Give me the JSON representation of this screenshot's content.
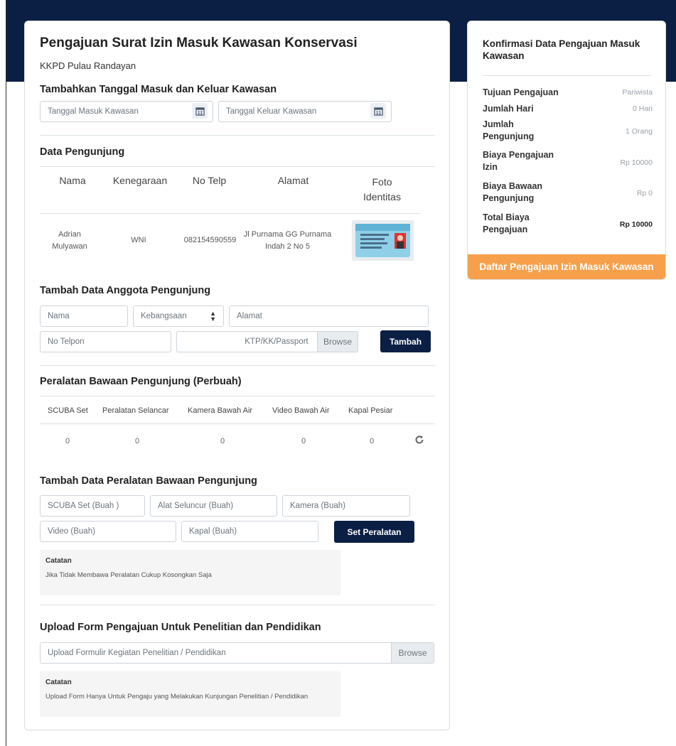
{
  "form": {
    "title": "Pengajuan Surat Izin Masuk Kawasan Konservasi",
    "subtitle": "KKPD Pulau Randayan",
    "dates_section": {
      "heading": "Tambahkan Tanggal Masuk dan Keluar Kawasan",
      "entry_placeholder": "Tanggal Masuk Kawasan",
      "exit_placeholder": "Tanggal Keluar Kawasan"
    },
    "visitors_section": {
      "heading": "Data Pengunjung",
      "columns": [
        "Nama",
        "Kenegaraan",
        "No Telp",
        "Alamat",
        "Foto Identitas"
      ],
      "rows": [
        {
          "nama": "Adrian Mulyawan",
          "kenegaraan": "WNI",
          "no_telp": "082154590559",
          "alamat": "Jl Purnama GG Purnama Indah 2 No 5"
        }
      ]
    },
    "add_member_section": {
      "heading": "Tambah Data Anggota Pengunjung",
      "name_placeholder": "Nama",
      "nationality_selected": "Kebangsaan",
      "address_placeholder": "Alamat",
      "phone_placeholder": "No Telpon",
      "id_file_placeholder": "KTP/KK/Passport",
      "browse_label": "Browse",
      "add_button": "Tambah"
    },
    "equipment_section": {
      "heading": "Peralatan Bawaan Pengunjung (Perbuah)",
      "columns": [
        "SCUBA Set",
        "Peralatan Selancar",
        "Kamera Bawah Air",
        "Video Bawah Air",
        "Kapal Pesiar"
      ],
      "values": [
        "0",
        "0",
        "0",
        "0",
        "0"
      ],
      "reset_icon": "refresh-icon"
    },
    "add_equipment_section": {
      "heading": "Tambah Data Peralatan Bawaan Pengunjung",
      "scuba_placeholder": "SCUBA Set (Buah )",
      "surf_placeholder": "Alat Seluncur (Buah)",
      "camera_placeholder": "Kamera (Buah)",
      "video_placeholder": "Video (Buah)",
      "boat_placeholder": "Kapal (Buah)",
      "set_button": "Set Peralatan",
      "note_title": "Catatan",
      "note_text": "Jika Tidak Membawa Peralatan Cukup Kosongkan Saja"
    },
    "upload_section": {
      "heading": "Upload Form Pengajuan Untuk Penelitian dan Pendidikan",
      "file_placeholder": "Upload Formulir Kegiatan Penelitian / Pendidikan",
      "browse_label": "Browse",
      "note_title": "Catatan",
      "note_text": "Upload Form Hanya Untuk Pengaju yang Melakukan Kunjungan Penelitian / Pendidikan"
    }
  },
  "summary": {
    "title": "Konfirmasi Data Pengajuan Masuk Kawasan",
    "rows": [
      {
        "label": "Tujuan Pengajuan",
        "value": "Pariwista"
      },
      {
        "label": "Jumlah Hari",
        "value": "0 Hari"
      },
      {
        "label": "Jumlah Pengunjung",
        "value": "1 Orang"
      },
      {
        "label": "Biaya Pengajuan Izin",
        "value": "Rp 10000"
      },
      {
        "label": "Biaya Bawaan Pengunjung",
        "value": "Rp 0"
      },
      {
        "label": "Total Biaya Pengajuan",
        "value": "Rp 10000"
      }
    ],
    "submit_button": "Daftar Pengajuan Izin Masuk Kawasan"
  },
  "colors": {
    "navy": "#0b1f44",
    "orange": "#f7a04b"
  }
}
